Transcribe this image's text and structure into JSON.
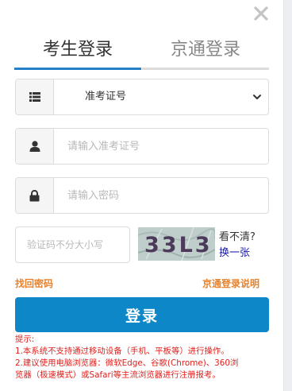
{
  "tabs": {
    "candidate_login": "考生登录",
    "jingtong_login": "京通登录"
  },
  "id_type": {
    "selected": "准考证号",
    "icon": "list-icon"
  },
  "username": {
    "placeholder": "请输入准考证号",
    "icon": "user-icon"
  },
  "password": {
    "placeholder": "请输入密码",
    "icon": "lock-icon"
  },
  "captcha": {
    "placeholder": "验证码不分大小写",
    "image_text": "33L3",
    "unclear_label": "看不清?",
    "refresh_label": "换一张"
  },
  "links": {
    "find_password": "找回密码",
    "jingtong_help": "京通登录说明"
  },
  "login_button": "登录",
  "tips": {
    "title": "提示:",
    "line1": "1.本系统不支持通过移动设备（手机、平板等）进行操作。",
    "line2": "2.建议使用电脑浏览器：微软Edge、谷歌(Chrome)、360浏",
    "line3": "览器（极速模式）或Safari等主流浏览器进行注册报考。"
  },
  "colors": {
    "accent_blue": "#0e87c9",
    "tab_underline": "#2680c9",
    "link_orange": "#e8822c",
    "tip_red": "#e0201d"
  }
}
